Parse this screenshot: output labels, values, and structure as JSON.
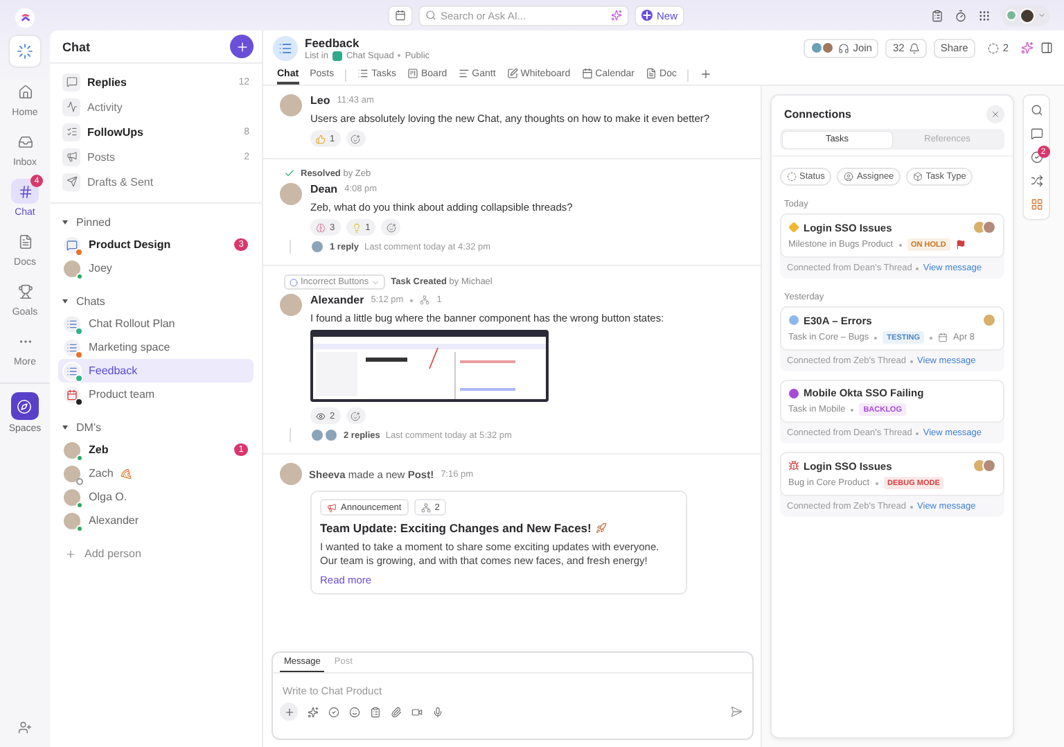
{
  "rail": {
    "items": [
      {
        "label": "Home",
        "selected": false
      },
      {
        "label": "Inbox",
        "selected": false
      },
      {
        "label": "Chat",
        "selected": true,
        "badge": "4"
      },
      {
        "label": "Docs",
        "selected": false
      },
      {
        "label": "Goals",
        "selected": false
      },
      {
        "label": "More",
        "selected": false
      }
    ],
    "spaces": "Spaces"
  },
  "top_bar": {
    "search_placeholder": "Search or Ask AI...",
    "new_label": "New"
  },
  "sidebar": {
    "title": "Chat",
    "views": [
      {
        "label": "Replies",
        "count": "12",
        "unread": true
      },
      {
        "label": "Activity",
        "unread": false
      },
      {
        "label": "FollowUps",
        "count": "8",
        "unread": true
      },
      {
        "label": "Posts",
        "count": "2",
        "unread": false
      },
      {
        "label": "Drafts & Sent",
        "unread": false
      }
    ],
    "sections": [
      {
        "title": "Pinned",
        "expanded": true,
        "items": [
          {
            "kind": "channel",
            "label": "Product Design",
            "unread": true,
            "badge": "3",
            "selected": false,
            "color": "#e8742c"
          },
          {
            "kind": "person",
            "label": "Joey",
            "unread": false,
            "selected": false,
            "online": true
          }
        ]
      },
      {
        "title": "Chats",
        "expanded": true,
        "items": [
          {
            "kind": "list",
            "label": "Chat Rollout Plan",
            "unread": false,
            "selected": false,
            "color": "#2fb38a"
          },
          {
            "kind": "list",
            "label": "Marketing space",
            "unread": false,
            "selected": false,
            "color": "#e8742c"
          },
          {
            "kind": "list",
            "label": "Feedback",
            "unread": false,
            "selected": true,
            "color": "#2fb38a"
          },
          {
            "kind": "calendar",
            "label": "Product team",
            "unread": false,
            "selected": false,
            "color": "#222222"
          }
        ]
      },
      {
        "title": "DM's",
        "expanded": true,
        "items": [
          {
            "kind": "person",
            "label": "Zeb",
            "unread": true,
            "badge": "1",
            "selected": false,
            "online": true
          },
          {
            "kind": "person",
            "label": "Zach",
            "unread": false,
            "selected": false,
            "online": false,
            "status_icon": true
          },
          {
            "kind": "person",
            "label": "Olga O.",
            "unread": false,
            "selected": false,
            "online": true
          },
          {
            "kind": "person",
            "label": "Alexander",
            "unread": false,
            "selected": false,
            "online": true
          }
        ]
      }
    ],
    "add_person": "Add person"
  },
  "header": {
    "title": "Feedback",
    "location_prefix": "List in",
    "space": "Chat Squad",
    "visibility": "Public",
    "join": "Join",
    "notification_count": "32",
    "share": "Share",
    "watchers": "2"
  },
  "view_tabs": [
    {
      "label": "Chat",
      "selected": true
    },
    {
      "label": "Posts",
      "selected": false
    },
    {
      "label": "Tasks",
      "selected": false
    },
    {
      "label": "Board",
      "selected": false
    },
    {
      "label": "Gantt",
      "selected": false
    },
    {
      "label": "Whiteboard",
      "selected": false
    },
    {
      "label": "Calendar",
      "selected": false
    },
    {
      "label": "Doc",
      "selected": false
    }
  ],
  "messages": [
    {
      "kind": "message",
      "author": "Leo",
      "time": "11:43 am",
      "text": "Users are absolutely loving the new Chat, any thoughts on how to make it even better?",
      "reactions": [
        {
          "kind": "thumbs-up",
          "count": "1"
        }
      ]
    },
    {
      "kind": "message",
      "resolved": {
        "label": "Resolved",
        "by": "by Zeb"
      },
      "author": "Dean",
      "time": "4:08 pm",
      "text": "Zeb, what do you think about adding collapsible threads?",
      "reactions": [
        {
          "kind": "brain",
          "count": "3"
        },
        {
          "kind": "bulb",
          "count": "1"
        }
      ],
      "thread": {
        "replies": "1 reply",
        "last": "Last comment today at 4:32 pm",
        "repliers": [
          {
            "kind": "person"
          }
        ]
      }
    },
    {
      "kind": "message",
      "task_banner": {
        "task": "Incorrect Buttons",
        "label": "Task Created",
        "by": "by Michael"
      },
      "author": "Alexander",
      "time": "5:12 pm",
      "subtasks": "1",
      "text": "I found a little bug where the banner component has the wrong button states:",
      "attachment": true,
      "reactions": [
        {
          "kind": "eyes",
          "count": "2"
        }
      ],
      "thread": {
        "replies": "2 replies",
        "last": "Last comment today at 5:32 pm",
        "repliers": [
          {
            "kind": "person"
          },
          {
            "kind": "person"
          }
        ]
      }
    },
    {
      "kind": "post",
      "headline": "**Sheeva** made a new **Post!**",
      "time": "7:16 pm",
      "tag": "Announcement",
      "tag_count": "2",
      "title": "Team Update: Exciting Changes and New Faces!",
      "body": "I wanted to take a moment to share some exciting updates with everyone. Our team is growing, and with that comes new faces, and fresh energy!",
      "link": "Read more"
    }
  ],
  "composer": {
    "tabs": [
      {
        "label": "Message",
        "selected": true
      },
      {
        "label": "Post",
        "selected": false
      }
    ],
    "placeholder": "Write to Chat Product"
  },
  "connections": {
    "title": "Connections",
    "tabs": [
      {
        "label": "Tasks",
        "selected": true
      },
      {
        "label": "References",
        "selected": false
      }
    ],
    "filters": [
      "Status",
      "Assignee",
      "Task Type"
    ],
    "groups": [
      {
        "label": "Today",
        "cards": [
          {
            "kind": "milestone",
            "color": "#f2b731",
            "title": "Login SSO Issues",
            "subtitle": "Milestone in Bugs Product",
            "tag": {
              "label": "ON HOLD",
              "color": "#c8731c"
            },
            "flagged": true,
            "assignees": [
              {
                "kind": "person"
              },
              {
                "kind": "person"
              }
            ],
            "source": "Connected from Dean's Thread",
            "link": "View message"
          }
        ]
      },
      {
        "label": "Yesterday",
        "cards": [
          {
            "kind": "task",
            "color": "#8db8ef",
            "title": "E30A – Errors",
            "subtitle": "Task in Core – Bugs",
            "tag": {
              "label": "TESTING",
              "color": "#4a86c5"
            },
            "date": "Apr 8",
            "flagged": false,
            "assignees": [
              {
                "kind": "person"
              }
            ],
            "source": "Connected from Zeb's Thread",
            "link": "View message"
          },
          {
            "kind": "task",
            "color": "#a64bd6",
            "title": "Mobile Okta SSO Failing",
            "subtitle": "Task in Mobile",
            "tag": {
              "label": "BACKLOG",
              "color": "#a64bd6"
            },
            "flagged": false,
            "source": "Connected from Dean's Thread",
            "link": "View message"
          },
          {
            "kind": "bug",
            "color": "#d63b3b",
            "title": "Login SSO Issues",
            "subtitle": "Bug in Core Product",
            "tag": {
              "label": "DEBUG MODE",
              "color": "#d63b3b"
            },
            "flagged": false,
            "assignees": [
              {
                "kind": "person"
              },
              {
                "kind": "person"
              }
            ],
            "source": "Connected from Zeb's Thread",
            "link": "View message"
          }
        ]
      }
    ]
  },
  "right_rail": {
    "tasks_badge": "2"
  }
}
